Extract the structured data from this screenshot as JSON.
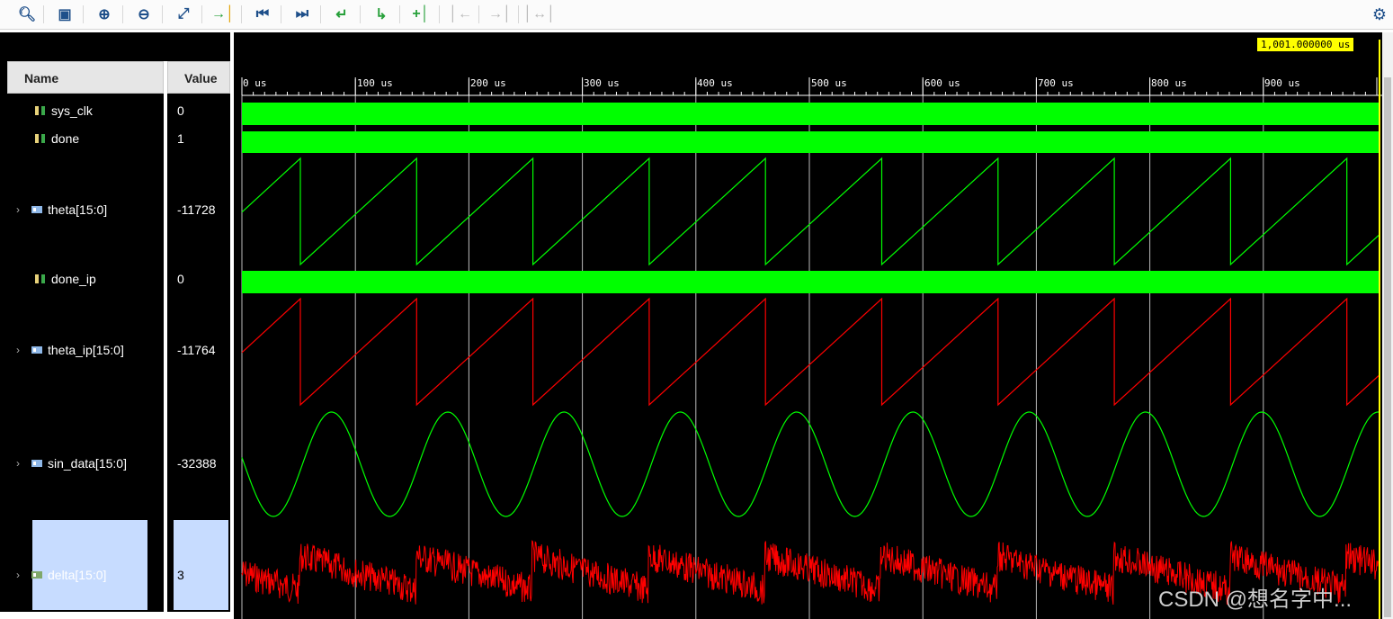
{
  "toolbar": {
    "icons": [
      "search-icon",
      "save-icon",
      "zoom-in-icon",
      "zoom-out-icon",
      "zoom-fit-icon",
      "go-to-cursor-icon",
      "go-to-start-icon",
      "go-to-end-icon",
      "previous-transition-icon",
      "next-transition-icon",
      "add-marker-icon",
      "previous-marker-icon",
      "next-marker-icon",
      "swap-cursors-icon"
    ],
    "gear_icon": "gear-icon"
  },
  "columns": {
    "name": "Name",
    "value": "Value"
  },
  "signals": [
    {
      "name": "sys_clk",
      "value": "0",
      "type": "bit",
      "expandable": false
    },
    {
      "name": "done",
      "value": "1",
      "type": "bit",
      "expandable": false
    },
    {
      "name": "theta[15:0]",
      "value": "-11728",
      "type": "bus",
      "expandable": true
    },
    {
      "name": "done_ip",
      "value": "0",
      "type": "bit",
      "expandable": false
    },
    {
      "name": "theta_ip[15:0]",
      "value": "-11764",
      "type": "bus",
      "expandable": true
    },
    {
      "name": "sin_data[15:0]",
      "value": "-32388",
      "type": "bus",
      "expandable": true
    },
    {
      "name": "delta[15:0]",
      "value": "3",
      "type": "bus",
      "expandable": true,
      "selected": true
    }
  ],
  "timeline": {
    "cursor_label": "1,001.000000 us",
    "ticks": [
      "0 us",
      "100 us",
      "200 us",
      "300 us",
      "400 us",
      "500 us",
      "600 us",
      "700 us",
      "800 us",
      "900 us"
    ]
  },
  "colors": {
    "green": "#00ff00",
    "red": "#ff0000",
    "cursor": "#ffff00",
    "selection": "#c7dcff"
  },
  "watermark": "CSDN @想名字中..."
}
